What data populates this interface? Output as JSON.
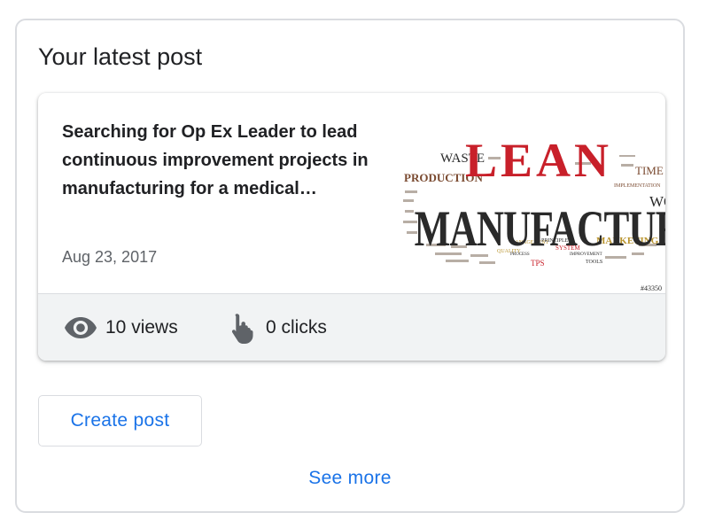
{
  "card": {
    "title": "Your latest post"
  },
  "post": {
    "text": "Searching for Op Ex Leader to lead continuous improvement projects in manufacturing for a medical…",
    "date": "Aug 23, 2017",
    "image": {
      "headline_top": "LEAN",
      "headline_main": "MANUFACTURING",
      "words": [
        "WASTE",
        "PRODUCTION",
        "TIME",
        "IMPLEMENTATION",
        "WO",
        "MARKETING",
        "MANAGEMENT",
        "PRINCIPLES",
        "SYSTEM",
        "IMPROVEMENT",
        "QUALITY",
        "PROCESS",
        "TPS",
        "TOOLS"
      ],
      "watermark": "#43350",
      "colors": {
        "red": "#c8202a",
        "dark": "#2a2a2a",
        "gold": "#b8932d",
        "brown": "#7a4a30"
      }
    }
  },
  "stats": {
    "views_label": "10 views",
    "clicks_label": "0 clicks",
    "views_icon": "eye-icon",
    "clicks_icon": "touch-icon"
  },
  "actions": {
    "create_post_label": "Create post",
    "see_more_label": "See more"
  },
  "colors": {
    "accent": "#1a73e8",
    "border": "#dadce0",
    "stats_bg": "#f1f3f4"
  }
}
